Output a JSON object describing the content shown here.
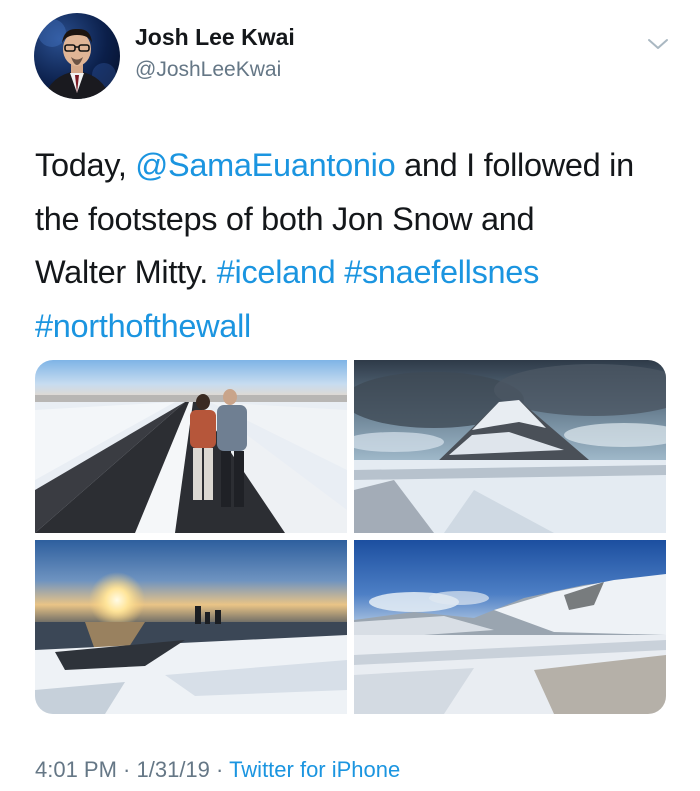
{
  "author": {
    "name": "Josh Lee Kwai",
    "handle": "@JoshLeeKwai"
  },
  "tweet": {
    "line1": {
      "pre": "Today, ",
      "mention": "@SamaEuantonio",
      "post": " and I followed in"
    },
    "line2": "the footsteps of both Jon Snow and",
    "line3": {
      "pre": "Walter Mitty. ",
      "tag1": "#iceland",
      "sep": " ",
      "tag2": "#snaefellsnes"
    },
    "line4": {
      "tag3": "#northofthewall"
    }
  },
  "media": {
    "photos": [
      {
        "icon": "photo-couple-on-road"
      },
      {
        "icon": "photo-kirkjufell-mountain"
      },
      {
        "icon": "photo-sunset-coast"
      },
      {
        "icon": "photo-snowy-valley"
      }
    ]
  },
  "footer": {
    "time": "4:01 PM",
    "dot1": " · ",
    "date": "1/31/19",
    "dot2": " · ",
    "source": "Twitter for iPhone"
  },
  "colors": {
    "link": "#1b95e0",
    "secondary_text": "#657786",
    "primary_text": "#14171a"
  }
}
